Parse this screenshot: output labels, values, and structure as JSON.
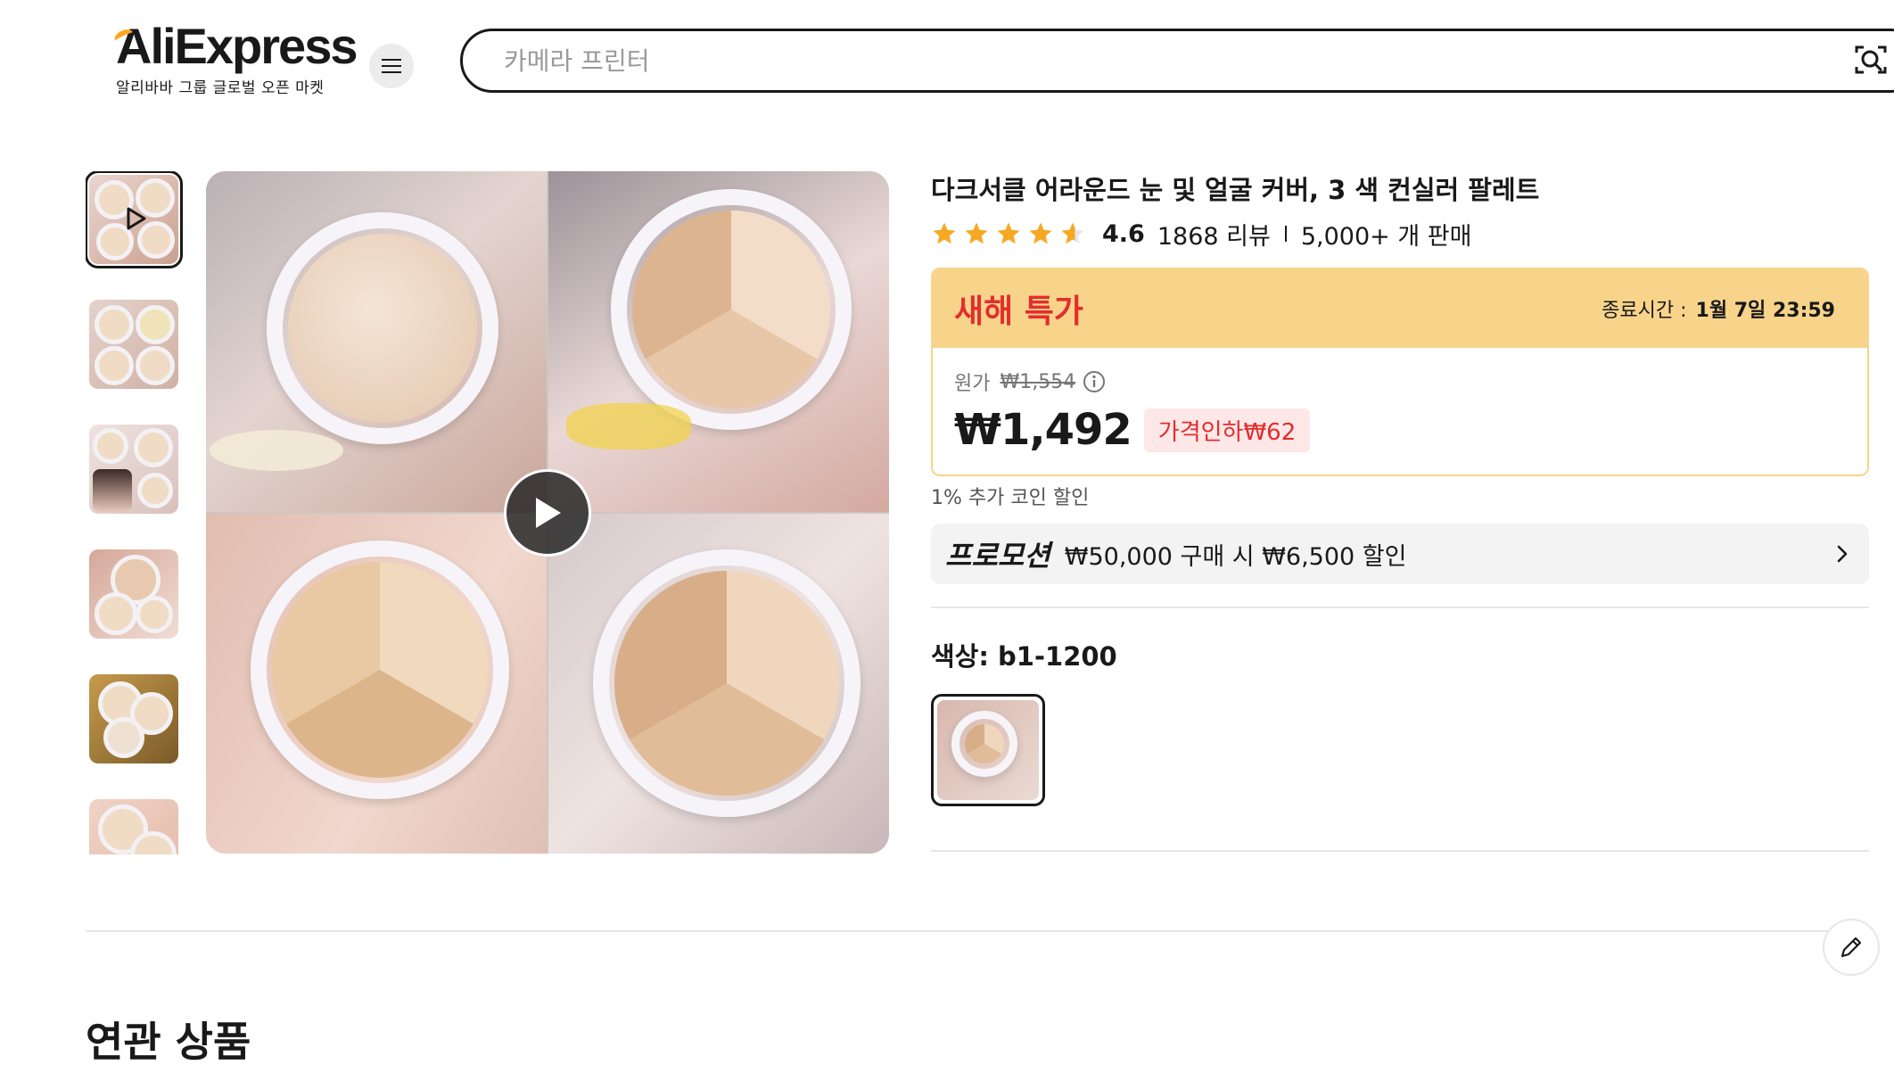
{
  "header": {
    "logo_text": "AliExpress",
    "logo_sub": "알리바바 그룹 글로벌 오픈 마켓",
    "search_placeholder": "카메라 프린터",
    "icons": [
      "menu-icon",
      "camera-search-icon"
    ]
  },
  "gallery": {
    "thumbnail_count": 6,
    "active_index": 0,
    "main_has_video": true
  },
  "product": {
    "title": "다크서클 어라운드 눈 및 얼굴 커버, 3 색 컨실러 팔레트",
    "rating": "4.6",
    "stars": 4.6,
    "reviews": "1868 리뷰",
    "sold": "5,000+ 개 판매"
  },
  "deal": {
    "title": "새해 특가",
    "end_label": "종료시간 :",
    "end_time": "1월 7일 23:59",
    "original_label": "원가",
    "original_price": "₩1,554",
    "price": "₩1,492",
    "discount": "가격인하₩62"
  },
  "coin_discount": "1% 추가 코인 할인",
  "promotion": {
    "label": "프로모션",
    "text": "₩50,000 구매 시 ₩6,500 할인"
  },
  "color": {
    "label": "색상: b1-1200"
  },
  "related": {
    "title": "연관 상품"
  },
  "colors": {
    "deal_bg": "#f7d48a",
    "accent_red": "#e22e2e",
    "star": "#f7a823",
    "text": "#191919"
  }
}
